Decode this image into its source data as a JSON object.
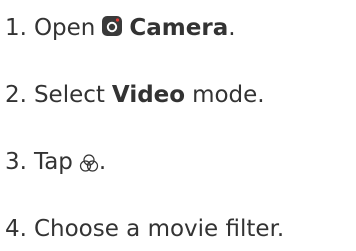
{
  "steps": [
    {
      "num": "1.",
      "pre": "Open",
      "bold": "Camera",
      "post": ".",
      "icon": "camera-app-icon"
    },
    {
      "num": "2.",
      "pre": "Select",
      "bold": "Video",
      "post": "mode."
    },
    {
      "num": "3.",
      "pre": "Tap",
      "post": ".",
      "icon": "filter-icon"
    },
    {
      "num": "4.",
      "pre": "Choose a movie filter."
    }
  ],
  "colors": {
    "text": "#333333",
    "camera_icon_bg": "#3a3a3a",
    "camera_icon_dot": "#e53935"
  }
}
